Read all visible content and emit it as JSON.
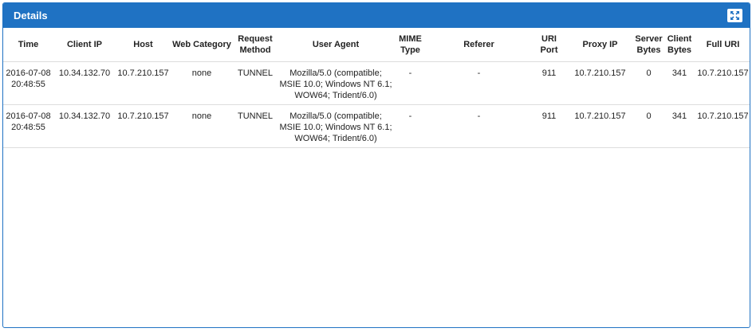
{
  "panel": {
    "title": "Details",
    "expand_icon": "expand-arrows-icon"
  },
  "columns": [
    "Time",
    "Client IP",
    "Host",
    "Web Category",
    "Request Method",
    "User Agent",
    "MIME Type",
    "Referer",
    "URI Port",
    "Proxy IP",
    "Server Bytes",
    "Client Bytes",
    "Full URI"
  ],
  "rows": [
    {
      "time": "2016-07-08 20:48:55",
      "client_ip": "10.34.132.70",
      "host": "10.7.210.157",
      "web_category": "none",
      "request_method": "TUNNEL",
      "user_agent": "Mozilla/5.0 (compatible; MSIE 10.0; Windows NT 6.1; WOW64; Trident/6.0)",
      "mime_type": "-",
      "referer": "-",
      "uri_port": "911",
      "proxy_ip": "10.7.210.157",
      "server_bytes": "0",
      "client_bytes": "341",
      "full_uri": "10.7.210.157"
    },
    {
      "time": "2016-07-08 20:48:55",
      "client_ip": "10.34.132.70",
      "host": "10.7.210.157",
      "web_category": "none",
      "request_method": "TUNNEL",
      "user_agent": "Mozilla/5.0 (compatible; MSIE 10.0; Windows NT 6.1; WOW64; Trident/6.0)",
      "mime_type": "-",
      "referer": "-",
      "uri_port": "911",
      "proxy_ip": "10.7.210.157",
      "server_bytes": "0",
      "client_bytes": "341",
      "full_uri": "10.7.210.157"
    }
  ]
}
